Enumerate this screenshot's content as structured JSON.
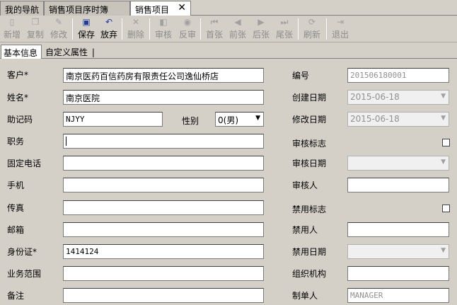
{
  "tabs": [
    {
      "label": "我的导航"
    },
    {
      "label": "销售项目序时簿"
    },
    {
      "label": "销售项目",
      "active": true,
      "close": "✕"
    }
  ],
  "toolbar": {
    "buttons": [
      {
        "label": "新增",
        "icon": "new-file-icon",
        "glyph": "▯",
        "enabled": false
      },
      {
        "label": "复制",
        "icon": "copy-icon",
        "glyph": "❐",
        "enabled": false
      },
      {
        "label": "修改",
        "icon": "edit-icon",
        "glyph": "✎",
        "enabled": false
      },
      {
        "label": "保存",
        "icon": "save-icon",
        "glyph": "▣",
        "enabled": true,
        "color": "#1f3a9c"
      },
      {
        "label": "放弃",
        "icon": "undo-icon",
        "glyph": "↶",
        "enabled": true,
        "color": "#1f3a9c"
      },
      {
        "label": "删除",
        "icon": "delete-icon",
        "glyph": "✕",
        "enabled": false
      },
      {
        "label": "审核",
        "icon": "audit-icon",
        "glyph": "◧",
        "enabled": false
      },
      {
        "label": "反审",
        "icon": "unaudit-icon",
        "glyph": "◉",
        "enabled": false
      },
      {
        "label": "首张",
        "icon": "first-icon",
        "glyph": "⏮",
        "enabled": false
      },
      {
        "label": "前张",
        "icon": "prev-icon",
        "glyph": "◀",
        "enabled": false
      },
      {
        "label": "后张",
        "icon": "next-icon",
        "glyph": "▶",
        "enabled": false
      },
      {
        "label": "尾张",
        "icon": "last-icon",
        "glyph": "⏭",
        "enabled": false
      },
      {
        "label": "刷新",
        "icon": "refresh-icon",
        "glyph": "⟳",
        "enabled": false
      },
      {
        "label": "退出",
        "icon": "exit-icon",
        "glyph": "⇥",
        "enabled": false
      }
    ]
  },
  "subtabs": [
    {
      "label": "基本信息",
      "active": true
    },
    {
      "label": "自定义属性"
    }
  ],
  "subtab_separator": "|",
  "form": {
    "customer_label": "客户*",
    "customer_value": "南京医药百信药房有限责任公司逸仙桥店",
    "name_label": "姓名*",
    "name_value": "南京医院",
    "mnemonic_label": "助记码",
    "mnemonic_value": "NJYY",
    "gender_label": "性别",
    "gender_value": "0(男)",
    "position_label": "职务",
    "position_value": "",
    "phone_label": "固定电话",
    "phone_value": "",
    "mobile_label": "手机",
    "mobile_value": "",
    "fax_label": "传真",
    "fax_value": "",
    "email_label": "邮箱",
    "email_value": "",
    "idcard_label": "身份证*",
    "idcard_value": "1414124",
    "scope_label": "业务范围",
    "scope_value": "",
    "remark_label": "备注",
    "remark_value": "",
    "code_label": "编号",
    "code_value": "201506180001",
    "created_label": "创建日期",
    "created_value": "2015-06-18",
    "modified_label": "修改日期",
    "modified_value": "2015-06-18",
    "audit_flag_label": "审核标志",
    "audit_date_label": "审核日期",
    "audit_date_value": "",
    "auditor_label": "审核人",
    "auditor_value": "",
    "disable_flag_label": "禁用标志",
    "disabled_by_label": "禁用人",
    "disabled_by_value": "",
    "disable_date_label": "禁用日期",
    "disable_date_value": "",
    "org_label": "组织机构",
    "org_value": "",
    "creator_label": "制单人",
    "creator_value": "MANAGER"
  },
  "dropdown_arrow": "▼",
  "colors": {
    "background": "#d4d0c8",
    "accent_blue": "#1f3a9c"
  }
}
